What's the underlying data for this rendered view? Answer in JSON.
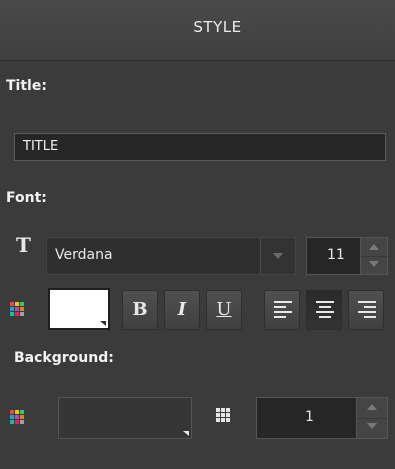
{
  "panel": {
    "header_title": "STYLE"
  },
  "title_section": {
    "label": "Title:",
    "input_value": "TITLE"
  },
  "font_section": {
    "label": "Font:",
    "font_family": "Verdana",
    "font_size": "11",
    "text_color": "#ffffff",
    "bold_label": "B",
    "italic_label": "I",
    "underline_label": "U",
    "alignment_selected": "center"
  },
  "background_section": {
    "label": "Background:",
    "opacity_value": "1"
  },
  "icons": {
    "font": "text-t-icon",
    "color_palette": "color-palette-icon",
    "opacity_grid": "opacity-grid-icon"
  }
}
